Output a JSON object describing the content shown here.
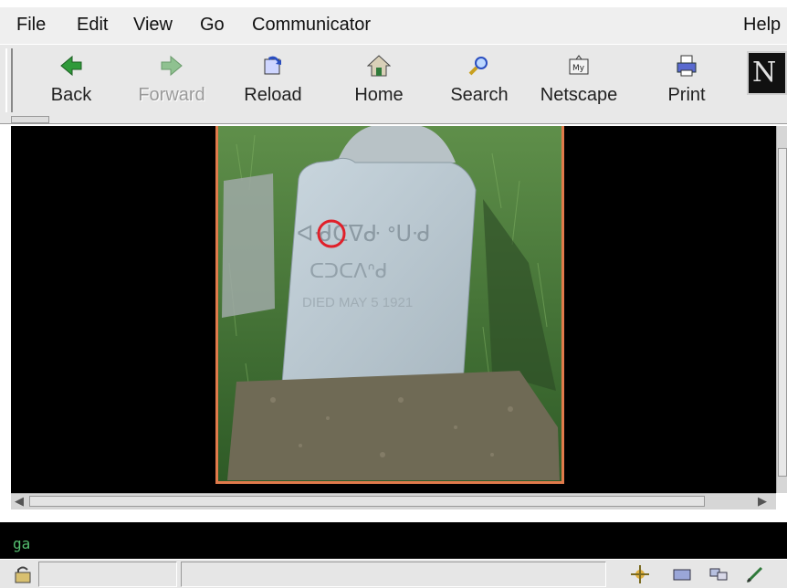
{
  "menu": [
    "File",
    "Edit",
    "View",
    "Go",
    "Communicator",
    "Help"
  ],
  "toolbar": {
    "buttons": [
      {
        "label": "Back",
        "icon": "back-arrow-icon",
        "enabled": true
      },
      {
        "label": "Forward",
        "icon": "forward-arrow-icon",
        "enabled": false
      },
      {
        "label": "Reload",
        "icon": "reload-icon",
        "enabled": true
      },
      {
        "label": "Home",
        "icon": "home-icon",
        "enabled": true
      },
      {
        "label": "Search",
        "icon": "search-icon",
        "enabled": true
      },
      {
        "label": "Netscape",
        "icon": "my-netscape-icon",
        "enabled": true
      },
      {
        "label": "Print",
        "icon": "print-icon",
        "enabled": true
      }
    ],
    "brand_logo": "N"
  },
  "content": {
    "image": {
      "subject": "gravestone-photo",
      "syllabics_line_1": "ᐊᑺᑕᐁᑻ ᐤᑌᑺ",
      "syllabics_line_2": "ᑕᑐᑕᐱᐢᑯ",
      "inscription": "DIED MAY 5 1921",
      "highlight_color": "#e0202a",
      "border_color": "#e07a4b"
    }
  },
  "location_text": "ga",
  "colors": {
    "content_bg": "#000000",
    "chrome_bg": "#e8e8e8",
    "location_text_color": "#55c070"
  }
}
